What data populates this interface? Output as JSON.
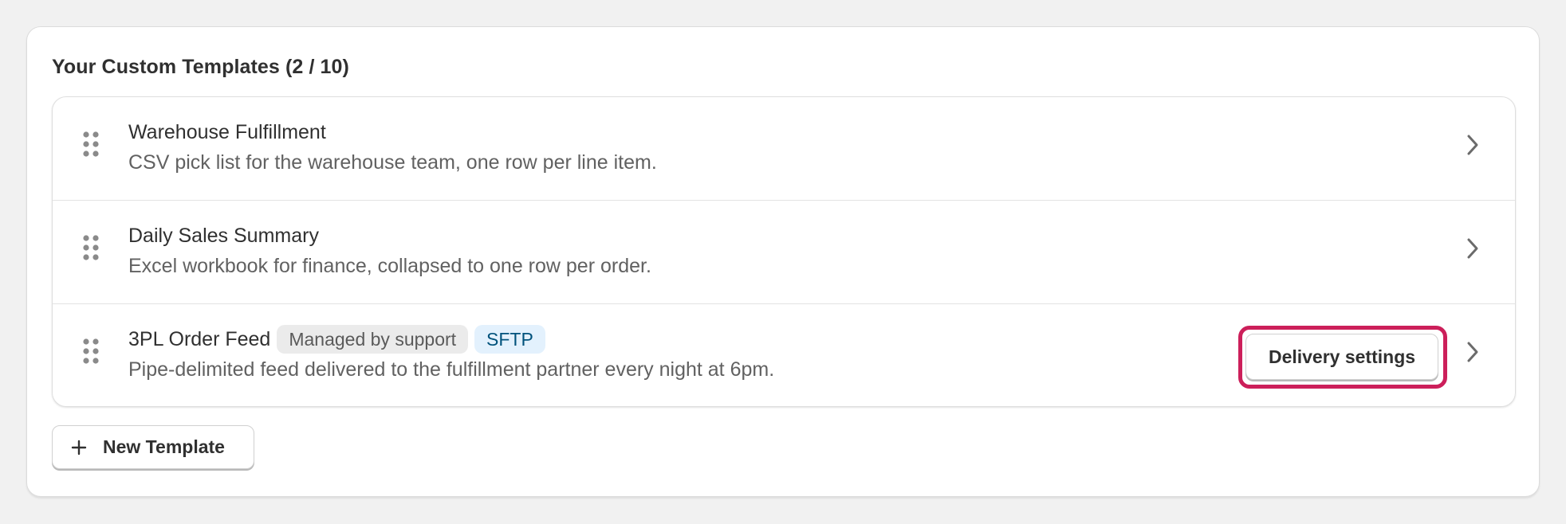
{
  "section": {
    "title": "Your Custom Templates (2 / 10)"
  },
  "templates": [
    {
      "title": "Warehouse Fulfillment",
      "description": "CSV pick list for the warehouse team, one row per line item."
    },
    {
      "title": "Daily Sales Summary",
      "description": "Excel workbook for finance, collapsed to one row per order."
    },
    {
      "title": "3PL Order Feed",
      "badges": [
        "Managed by support",
        "SFTP"
      ],
      "description": "Pipe-delimited feed delivered to the fulfillment partner every night at 6pm.",
      "action_label": "Delivery settings"
    }
  ],
  "actions": {
    "new_template_label": "New Template"
  },
  "icons": {
    "drag": "drag-handle-icon",
    "chevron": "chevron-right-icon",
    "plus": "plus-icon"
  },
  "colors": {
    "highlight": "#cc1f5a",
    "sftp_badge_bg": "#e3f1fd",
    "sftp_badge_text": "#00527c"
  }
}
